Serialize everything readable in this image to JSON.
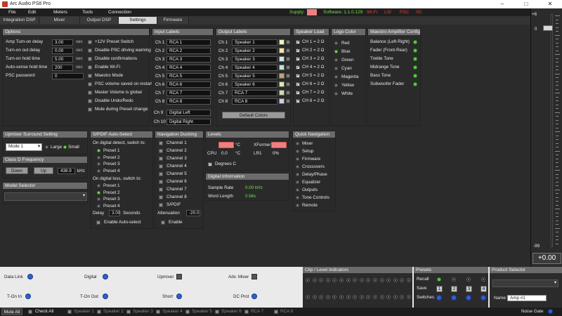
{
  "window": {
    "title": "Arc Audio PS8 Pro",
    "minimize": "–",
    "maximize": "□",
    "close": "✕"
  },
  "menu": {
    "items": [
      "File",
      "Edit",
      "Meters",
      "Tools",
      "Connection"
    ]
  },
  "status": {
    "supply_label": "Supply:",
    "software_label": "Software: 1.1.0.129",
    "wifi": "Wi-Fi",
    "lsi": "LSI",
    "psc": "PSC",
    "isi": "ISI"
  },
  "tabs": [
    {
      "label": "Integration DSP",
      "active": false
    },
    {
      "label": "Mixer",
      "active": false
    },
    {
      "label": "Output DSP",
      "active": false
    },
    {
      "label": "Settings",
      "active": true
    },
    {
      "label": "Firmware",
      "active": false
    }
  ],
  "options": {
    "title": "Options",
    "rows": [
      {
        "label": "Amp Turn-on delay",
        "value": "3.00",
        "unit": "sec"
      },
      {
        "label": "Turn-on out delay",
        "value": "0.00",
        "unit": "sec"
      },
      {
        "label": "Turn-on hold time",
        "value": "5.00",
        "unit": "sec"
      },
      {
        "label": "Auto-sense hold time",
        "value": "200",
        "unit": "sec"
      },
      {
        "label": "PSC password",
        "value": "0",
        "unit": ""
      }
    ],
    "checks": [
      {
        "label": "+12V Preset Switch",
        "on": false
      },
      {
        "label": "Disable PSC driving warning",
        "on": false
      },
      {
        "label": "Disable confirmations",
        "on": false
      },
      {
        "label": "Enable Wi-Fi",
        "on": false
      },
      {
        "label": "Maestro Mode",
        "on": false
      },
      {
        "label": "PSC volume saved on restart",
        "on": false
      },
      {
        "label": "Master Volume is global",
        "on": false
      },
      {
        "label": "Disable Undo/Redo",
        "on": false
      },
      {
        "label": "Mute during Preset change",
        "on": false
      }
    ]
  },
  "input_labels": {
    "title": "Input Labels",
    "rows": [
      {
        "ch": "Ch 1",
        "label": "RCA 1"
      },
      {
        "ch": "Ch 2",
        "label": "RCA 2"
      },
      {
        "ch": "Ch 3",
        "label": "RCA 3"
      },
      {
        "ch": "Ch 4",
        "label": "RCA 4"
      },
      {
        "ch": "Ch 5",
        "label": "RCA 5"
      },
      {
        "ch": "Ch 6",
        "label": "RCA 6"
      },
      {
        "ch": "Ch 7",
        "label": "RCA 7"
      },
      {
        "ch": "Ch 8",
        "label": "RCA 8"
      },
      {
        "ch": "Ch 9",
        "label": "Digital Left"
      },
      {
        "ch": "Ch 10",
        "label": "Digital Right"
      }
    ]
  },
  "output_labels": {
    "title": "Output Labels",
    "default_button": "Default Colors",
    "rows": [
      {
        "ch": "Ch 1",
        "label": "Speaker 1",
        "color": "#f5f0b0"
      },
      {
        "ch": "Ch 2",
        "label": "Speaker 2",
        "color": "#f5e6a0"
      },
      {
        "ch": "Ch 3",
        "label": "Speaker 3",
        "color": "#c9e4f5"
      },
      {
        "ch": "Ch 4",
        "label": "Speaker 4",
        "color": "#bfe3d0"
      },
      {
        "ch": "Ch 5",
        "label": "Speaker 5",
        "color": "#c8a070"
      },
      {
        "ch": "Ch 6",
        "label": "Speaker 6",
        "color": "#d8e8b0"
      },
      {
        "ch": "Ch 7",
        "label": "RCA 7",
        "color": "#c8e0a8"
      },
      {
        "ch": "Ch 8",
        "label": "RCA 8",
        "color": "#d8c8e8"
      }
    ]
  },
  "speaker_load": {
    "title": "Speaker Load",
    "rows": [
      "CH 1 = 2 Ω",
      "CH 2 = 2 Ω",
      "CH 3 = 2 Ω",
      "CH 4 = 2 Ω",
      "CH 5 = 2 Ω",
      "CH 6 = 2 Ω",
      "CH 7 = 2 Ω",
      "CH 8 = 2 Ω"
    ]
  },
  "logo_color": {
    "title": "Logo Color",
    "options": [
      {
        "label": "Red",
        "on": false
      },
      {
        "label": "Blue",
        "on": true
      },
      {
        "label": "Green",
        "on": false
      },
      {
        "label": "Cyan",
        "on": false
      },
      {
        "label": "Magenta",
        "on": false
      },
      {
        "label": "Yellow",
        "on": false
      },
      {
        "label": "White",
        "on": false
      }
    ]
  },
  "maestro": {
    "title": "Maestro Amplifier Config",
    "rows": [
      "Balance (Left-Right)",
      "Fader    (Front-Rear)",
      "Treble Tone",
      "Midrange Tone",
      "Bass Tone",
      "Subwoofer Fader"
    ]
  },
  "upmixer": {
    "title": "Upmixer Surround Setting",
    "mode": "Mode 1",
    "large": "Large",
    "small": "Small"
  },
  "class_d": {
    "title": "Class D Frequency",
    "down": "Down",
    "up": "Up",
    "value": "438.9",
    "unit": "kHz"
  },
  "model_selector": {
    "title": "Model Selector",
    "value": ""
  },
  "spdif": {
    "title": "S/PDIF Auto-Select",
    "detect_label": "On digital detect, switch to:",
    "detect_presets": [
      {
        "label": "Preset 1",
        "on": true
      },
      {
        "label": "Preset 2",
        "on": false
      },
      {
        "label": "Preset 3",
        "on": false
      },
      {
        "label": "Preset 4",
        "on": false
      }
    ],
    "loss_label": "On digital loss, switch to:",
    "loss_presets": [
      {
        "label": "Preset 1",
        "on": false
      },
      {
        "label": "Preset 2",
        "on": true
      },
      {
        "label": "Preset 3",
        "on": false
      },
      {
        "label": "Preset 4",
        "on": false
      }
    ],
    "delay_label": "Delay",
    "delay_value": "3.00",
    "delay_unit": "Seconds",
    "enable": "Enable Auto-select"
  },
  "ducking": {
    "title": "Navigation Ducking",
    "channels": [
      "Channel 1",
      "Channel 2",
      "Channel 3",
      "Channel 4",
      "Channel 5",
      "Channel 6",
      "Channel 7",
      "Channel 8",
      "S/PDIF"
    ],
    "attenuation_label": "Attenuation",
    "attenuation_value": "-20.0",
    "enable": "Enable"
  },
  "levels": {
    "title": "Levels",
    "cpu_label": "CPU",
    "temp_unit": "°C",
    "xformer_label": "XFormer",
    "cpu_value": "0.0",
    "lr1_label": "LR1",
    "lr1_value": "0%",
    "degrees": "Degrees C"
  },
  "digital_info": {
    "title": "Digital Information",
    "sample_rate_label": "Sample Rate",
    "sample_rate_value": "0.00 kHz",
    "word_length_label": "Word Length",
    "word_length_value": "0 bits"
  },
  "quick_nav": {
    "title": "Quick Navigation",
    "items": [
      "Mixer",
      "Setup",
      "Firmware",
      "Crossovers",
      "Delay/Phase",
      "Equalizer",
      "Outputs",
      "Tone Controls",
      "Remote"
    ]
  },
  "master": {
    "top": "+6",
    "zero": "0",
    "bottom": "-99",
    "value": "+0.00"
  },
  "indicators": {
    "data_link": "Data Link",
    "digital": "Digital",
    "upmixer": "Upmixer",
    "adv_mixer": "Adv. Mixer",
    "t_on_in": "T-On In",
    "t_on_out": "T-On Out",
    "short": "Short",
    "dc_prot": "DC Prot"
  },
  "clip": {
    "title": "Clip / Level Indicators"
  },
  "presets": {
    "title": "Presets",
    "recall": "Recall",
    "save": "Save",
    "switches": "Switches",
    "numbers": [
      "1",
      "2",
      "3",
      "4"
    ]
  },
  "product": {
    "title": "Product Selector",
    "name_label": "Name:",
    "name_value": "Amp #1"
  },
  "footer": {
    "mute_all": "Mute All",
    "check_all": "Check All",
    "channels": [
      "Speaker 1",
      "Speaker 2",
      "Speaker 3",
      "Speaker 4",
      "Speaker 5",
      "Speaker 6",
      "RCA 7",
      "RCA 8"
    ],
    "noise_gate": "Noise Gate"
  }
}
